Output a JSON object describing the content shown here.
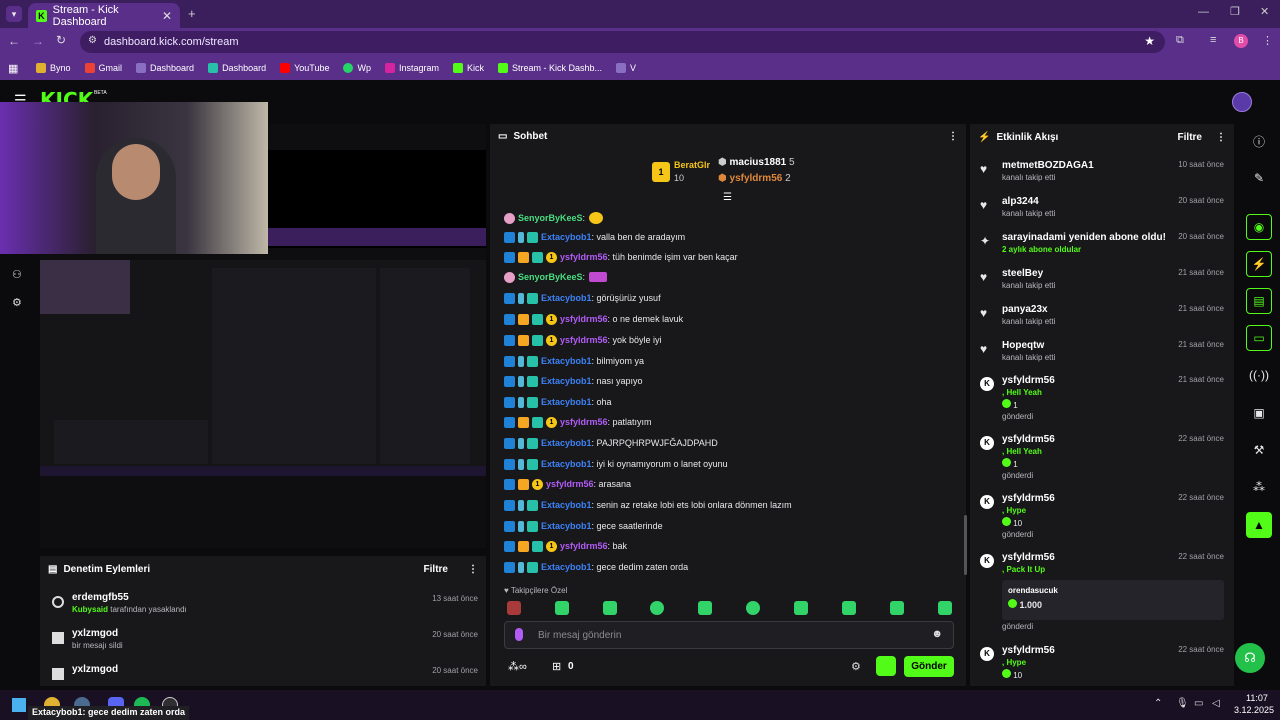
{
  "browser": {
    "tab_title": "Stream - Kick Dashboard",
    "url": "dashboard.kick.com/stream",
    "bookmarks": [
      "Byno",
      "Gmail",
      "Dashboard",
      "Dashboard",
      "YouTube",
      "Wp",
      "Instagram",
      "Kick",
      "Stream - Kick Dashb...",
      "V"
    ],
    "profile_initial": "B"
  },
  "kick": {
    "logo": "KICK",
    "beta": "BETA"
  },
  "moderation": {
    "title": "Denetim Eylemleri",
    "filter": "Filtre",
    "rows": [
      {
        "name": "erdemgfb55",
        "actor": "Kubysaid",
        "action": " tarafından yasaklandı",
        "time": "13 saat önce"
      },
      {
        "name": "yxlzmgod",
        "actor": "",
        "action": "bir mesajı sildi",
        "time": "20 saat önce"
      },
      {
        "name": "yxlzmgod",
        "actor": "",
        "action": "",
        "time": "20 saat önce"
      }
    ]
  },
  "chat": {
    "title": "Sohbet",
    "top_gifters": [
      {
        "name": "BeratGlr",
        "count": "10"
      },
      {
        "name": "macius1881",
        "count": "5"
      },
      {
        "name": "ysfyldrm56",
        "count": "2"
      }
    ],
    "messages": [
      {
        "user": "SenyorByKeeS",
        "text": "",
        "color": "green"
      },
      {
        "user": "Extacybob1",
        "text": ": valla ben de aradayım",
        "color": "blue"
      },
      {
        "user": "ysfyldrm56",
        "text": ": tüh benimde işim var ben kaçar",
        "color": "purple"
      },
      {
        "user": "SenyorByKeeS",
        "text": "",
        "color": "green"
      },
      {
        "user": "Extacybob1",
        "text": ": görüşürüz yusuf",
        "color": "blue"
      },
      {
        "user": "ysfyldrm56",
        "text": ": o ne demek lavuk",
        "color": "purple"
      },
      {
        "user": "ysfyldrm56",
        "text": ": yok böyle iyi",
        "color": "purple"
      },
      {
        "user": "Extacybob1",
        "text": ": bilmiyom ya",
        "color": "blue"
      },
      {
        "user": "Extacybob1",
        "text": ": nası yapıyo",
        "color": "blue"
      },
      {
        "user": "Extacybob1",
        "text": ": oha",
        "color": "blue"
      },
      {
        "user": "ysfyldrm56",
        "text": ": patlatıyım",
        "color": "purple"
      },
      {
        "user": "Extacybob1",
        "text": ": PAJRPQHRPWJFĞAJDPAHD",
        "color": "blue"
      },
      {
        "user": "Extacybob1",
        "text": ": iyi ki oynamıyorum o lanet oyunu",
        "color": "blue"
      },
      {
        "user": "ysfyldrm56",
        "text": ": arasana",
        "color": "purple"
      },
      {
        "user": "Extacybob1",
        "text": ": senin az retake lobi ets lobi onlara dönmen lazım",
        "color": "blue"
      },
      {
        "user": "Extacybob1",
        "text": ": gece saatlerinde",
        "color": "blue"
      },
      {
        "user": "ysfyldrm56",
        "text": ": bak",
        "color": "purple"
      },
      {
        "user": "Extacybob1",
        "text": ": gece dedim zaten orda",
        "color": "blue"
      }
    ],
    "emote_label": "Takipçilere Özel",
    "input_placeholder": "Bir mesaj gönderin",
    "count": "0",
    "send": "Gönder"
  },
  "activity": {
    "title": "Etkinlik Akışı",
    "filter": "Filtre",
    "items": [
      {
        "name": "metmetBOZDAGA1",
        "sub": "kanalı takip etti",
        "time": "10 saat önce"
      },
      {
        "name": "alp3244",
        "sub": "kanalı takip etti",
        "time": "20 saat önce"
      },
      {
        "name": "sarayinadami yeniden abone oldu!",
        "sub": "2 aylık abone oldular",
        "time": "20 saat önce"
      },
      {
        "name": "steelBey",
        "sub": "kanalı takip etti",
        "time": "21 saat önce"
      },
      {
        "name": "panya23x",
        "sub": "kanalı takip etti",
        "time": "21 saat önce"
      },
      {
        "name": "Hopeqtw",
        "sub": "kanalı takip etti",
        "time": "21 saat önce"
      },
      {
        "name": "ysfyldrm56",
        "reward": "Hell Yeah",
        "amount": "1",
        "sub": "gönderdi",
        "time": "21 saat önce"
      },
      {
        "name": "ysfyldrm56",
        "reward": "Hell Yeah",
        "amount": "1",
        "sub": "gönderdi",
        "time": "22 saat önce"
      },
      {
        "name": "ysfyldrm56",
        "reward": "Hype",
        "amount": "10",
        "sub": "gönderdi",
        "time": "22 saat önce"
      },
      {
        "name": "ysfyldrm56",
        "reward": "Pack It Up",
        "note_user": "orendasucuk",
        "amount": "1.000",
        "sub": "gönderdi",
        "time": "22 saat önce"
      },
      {
        "name": "ysfyldrm56",
        "reward": "Hype",
        "amount": "10",
        "time": "22 saat önce"
      }
    ]
  },
  "taskbar": {
    "notification": "Extacybob1: gece dedim zaten orda",
    "time": "11:07",
    "date": "3.12.2025"
  }
}
